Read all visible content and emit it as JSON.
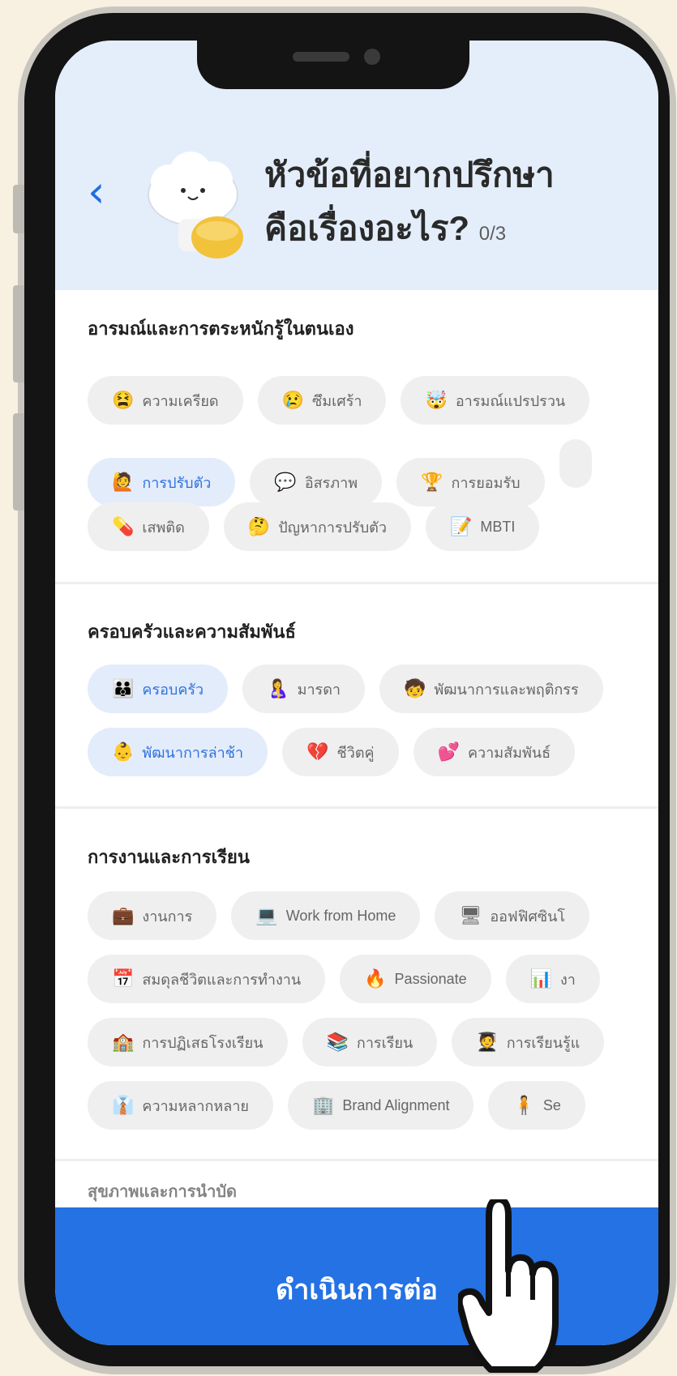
{
  "header": {
    "title_line1": "หัวข้อที่อยากปรึกษา",
    "title_line2": "คือเรื่องอะไร?",
    "counter": "0/3"
  },
  "sections": [
    {
      "title": "อารมณ์และการตระหนักรู้ในตนเอง",
      "rows": [
        [
          {
            "icon": "tired-face-icon",
            "emoji": "😫",
            "label": "ความเครียด",
            "selected": false
          },
          {
            "icon": "crying-face-icon",
            "emoji": "😢",
            "label": "ซึมเศร้า",
            "selected": false
          },
          {
            "icon": "exploding-head-icon",
            "emoji": "🤯",
            "label": "อารมณ์แปรปรวน",
            "selected": false
          }
        ],
        [
          {
            "icon": "person-raising-hand-icon",
            "emoji": "🙋",
            "label": "การปรับตัว",
            "selected": true
          },
          {
            "icon": "speech-bubble-icon",
            "emoji": "💬",
            "label": "อิสรภาพ",
            "selected": false
          },
          {
            "icon": "trophy-icon",
            "emoji": "🏆",
            "label": "การยอมรับ",
            "selected": false
          }
        ],
        [
          {
            "icon": "pill-icon",
            "emoji": "💊",
            "label": "เสพติด",
            "selected": false
          },
          {
            "icon": "thinking-face-icon",
            "emoji": "🤔",
            "label": "ปัญหาการปรับตัว",
            "selected": false
          },
          {
            "icon": "memo-icon",
            "emoji": "📝",
            "label": "MBTI",
            "selected": false
          }
        ]
      ]
    },
    {
      "title": "ครอบครัวและความสัมพันธ์",
      "rows": [
        [
          {
            "icon": "family-icon",
            "emoji": "👪",
            "label": "ครอบครัว",
            "selected": true
          },
          {
            "icon": "mother-icon",
            "emoji": "🤱",
            "label": "มารดา",
            "selected": false
          },
          {
            "icon": "child-development-icon",
            "emoji": "🧒",
            "label": "พัฒนาการและพฤติกรร",
            "selected": false
          }
        ],
        [
          {
            "icon": "baby-icon",
            "emoji": "👶",
            "label": "พัฒนาการล่าช้า",
            "selected": true
          },
          {
            "icon": "broken-heart-icon",
            "emoji": "💔",
            "label": "ชีวิตคู่",
            "selected": false
          },
          {
            "icon": "two-hearts-icon",
            "emoji": "💕",
            "label": "ความสัมพันธ์",
            "selected": false
          }
        ]
      ]
    },
    {
      "title": "การงานและการเรียน",
      "rows": [
        [
          {
            "icon": "briefcase-icon",
            "emoji": "💼",
            "label": "งานการ",
            "selected": false
          },
          {
            "icon": "laptop-icon",
            "emoji": "💻",
            "label": "Work from Home",
            "selected": false
          },
          {
            "icon": "desktop-icon",
            "emoji": "🖥",
            "label": "ออฟฟิศซินโ",
            "selected": false
          }
        ],
        [
          {
            "icon": "calendar-icon",
            "emoji": "📅",
            "label": "สมดุลชีวิตและการทำงาน",
            "selected": false
          },
          {
            "icon": "fire-icon",
            "emoji": "🔥",
            "label": "Passionate",
            "selected": false
          },
          {
            "icon": "bar-chart-icon",
            "emoji": "📊",
            "label": "งา",
            "selected": false
          }
        ],
        [
          {
            "icon": "school-icon",
            "emoji": "🏫",
            "label": "การปฏิเสธโรงเรียน",
            "selected": false
          },
          {
            "icon": "books-icon",
            "emoji": "📚",
            "label": "การเรียน",
            "selected": false
          },
          {
            "icon": "student-icon",
            "emoji": "🧑‍🎓",
            "label": "การเรียนรู้แ",
            "selected": false
          }
        ],
        [
          {
            "icon": "tie-icon",
            "emoji": "👔",
            "label": "ความหลากหลาย",
            "selected": false
          },
          {
            "icon": "office-building-icon",
            "emoji": "🏢",
            "label": "Brand Alignment",
            "selected": false
          },
          {
            "icon": "person-standing-icon",
            "emoji": "🧍",
            "label": "Se",
            "selected": false
          }
        ]
      ]
    }
  ],
  "next_section_title_partial": "สุขภาพและการนำบัด",
  "cta": {
    "label": "ดำเนินการต่อ"
  },
  "colors": {
    "primary": "#2472e3",
    "header_bg": "#e4eefb",
    "chip_bg": "#efefef",
    "chip_selected_bg": "#e3ecfb",
    "chip_selected_text": "#2f72dd"
  }
}
